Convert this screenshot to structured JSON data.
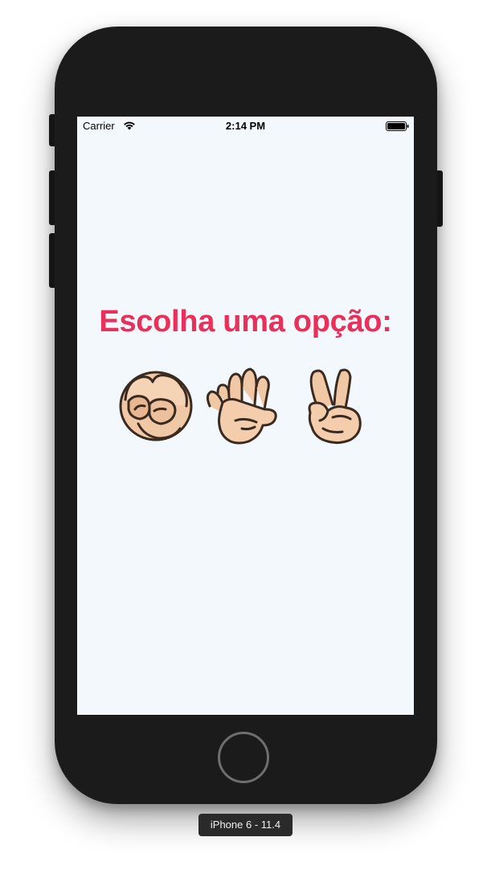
{
  "status_bar": {
    "carrier": "Carrier",
    "time": "2:14 PM",
    "wifi_icon": "wifi-icon",
    "battery_icon": "battery-icon"
  },
  "main": {
    "heading": "Escolha uma opção:",
    "heading_color": "#e8305a",
    "background_color": "#f2f8fc",
    "options": [
      {
        "name": "rock",
        "icon": "fist-hand-icon"
      },
      {
        "name": "paper",
        "icon": "open-hand-icon"
      },
      {
        "name": "scissors",
        "icon": "victory-hand-icon"
      }
    ]
  },
  "simulator": {
    "device_label": "iPhone 6 - 11.4"
  }
}
